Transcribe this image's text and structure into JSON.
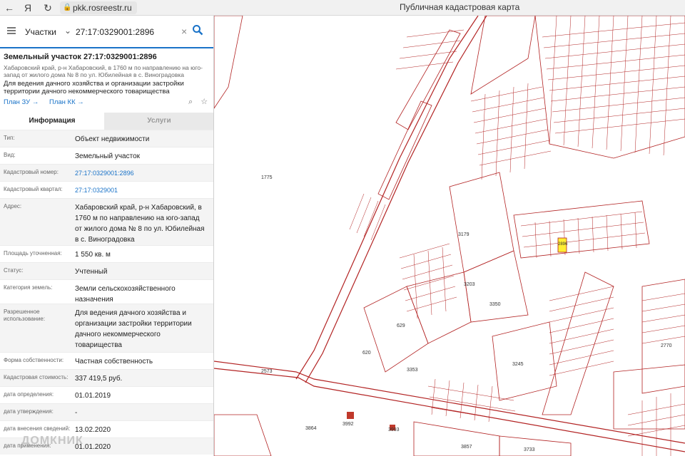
{
  "browser": {
    "url": "pkk.rosreestr.ru",
    "page_title": "Публичная кадастровая карта"
  },
  "search": {
    "type_label": "Участки",
    "query": "27:17:0329001:2896"
  },
  "parcel": {
    "title": "Земельный участок 27:17:0329001:2896",
    "address": "Хабаровский край, р-н Хабаровский, в 1760 м по направлению на юго-запад от жилого дома № 8 по ул. Юбилейная в с. Виноградовка",
    "usage": "Для ведения дачного хозяйства и организации застройки территории дачного некоммерческого товарищества",
    "plan_zu": "План ЗУ →",
    "plan_kk": "План КК →"
  },
  "tabs": [
    "Информация",
    "Услуги"
  ],
  "info_rows": [
    {
      "label": "Тип:",
      "value": "Объект недвижимости"
    },
    {
      "label": "Вид:",
      "value": "Земельный участок"
    },
    {
      "label": "Кадастровый номер:",
      "value": "27:17:0329001:2896"
    },
    {
      "label": "Кадастровый квартал:",
      "value": "27:17:0329001"
    },
    {
      "label": "Адрес:",
      "value": "Хабаровский край, р-н Хабаровский, в 1760 м по направлению на юго-запад от жилого дома № 8 по ул. Юбилейная в с. Виноградовка"
    },
    {
      "label": "Площадь уточненная:",
      "value": "1 550 кв. м"
    },
    {
      "label": "Статус:",
      "value": "Учтенный"
    },
    {
      "label": "Категория земель:",
      "value": "Земли сельскохозяйственного назначения"
    },
    {
      "label": "Разрешенное использование:",
      "value": "Для ведения дачного хозяйства и организации застройки территории дачного некоммерческого товарищества"
    },
    {
      "label": "Форма собственности:",
      "value": "Частная собственность"
    },
    {
      "label": "Кадастровая стоимость:",
      "value": "337 419,5 руб."
    },
    {
      "label": "дата определения:",
      "value": "01.01.2019"
    },
    {
      "label": "дата утверждения:",
      "value": "-"
    },
    {
      "label": "дата внесения сведений:",
      "value": "13.02.2020"
    },
    {
      "label": "дата применения:",
      "value": "01.01.2020"
    }
  ],
  "map_labels": [
    "1775",
    "3179",
    "3203",
    "3350",
    "629",
    "620",
    "3353",
    "3245",
    "2770",
    "2573",
    "3864",
    "3992",
    "3993",
    "3857",
    "3733",
    "2896"
  ],
  "watermark": "ДОМКНИК",
  "colors": {
    "accent": "#1a73c8",
    "parcel_line": "#b22222",
    "selected_parcel": "#ffee33"
  }
}
